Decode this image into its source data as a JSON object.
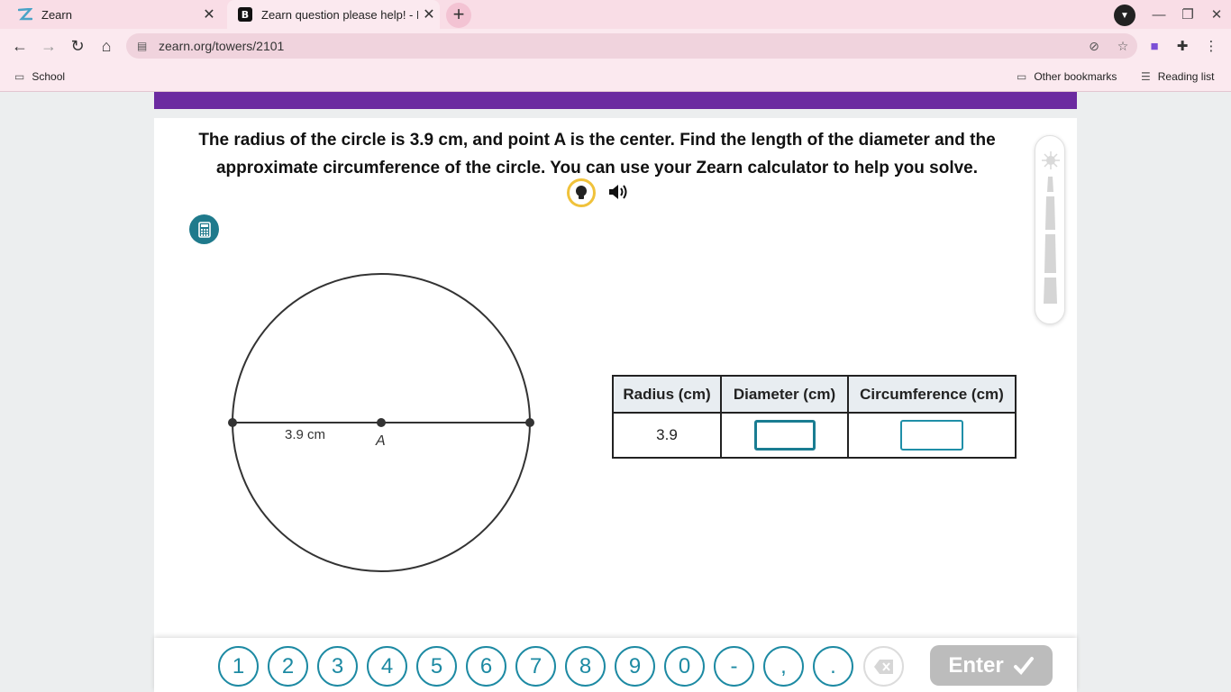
{
  "browser": {
    "tabs": [
      {
        "title": "Zearn",
        "active": false
      },
      {
        "title": "Zearn question please help! - Bra",
        "active": true
      }
    ],
    "new_tab_symbol": "+",
    "address": "zearn.org/towers/2101",
    "bookmarks": {
      "left": [
        {
          "label": "School",
          "icon": "folder-icon"
        }
      ],
      "right": [
        {
          "label": "Other bookmarks",
          "icon": "folder-icon"
        },
        {
          "label": "Reading list",
          "icon": "reading-list-icon"
        }
      ]
    }
  },
  "page": {
    "question": "The radius of the circle is 3.9 cm, and point A is the center. Find the length of the diameter and the approximate circumference of the circle. You can use your Zearn calculator to help you solve.",
    "figure": {
      "radius_label": "3.9 cm",
      "center_label": "A"
    },
    "table": {
      "headers": [
        "Radius (cm)",
        "Diameter (cm)",
        "Circumference (cm)"
      ],
      "radius_value": "3.9",
      "diameter_value": "",
      "circumference_value": ""
    },
    "keypad": {
      "keys": [
        "1",
        "2",
        "3",
        "4",
        "5",
        "6",
        "7",
        "8",
        "9",
        "0",
        "-",
        ",",
        "."
      ],
      "enter_label": "Enter"
    }
  },
  "colors": {
    "accent": "#1d8aa3",
    "banner": "#6b2aa0",
    "hint_ring": "#f0c23b",
    "tab_strip": "#f9dde6"
  }
}
